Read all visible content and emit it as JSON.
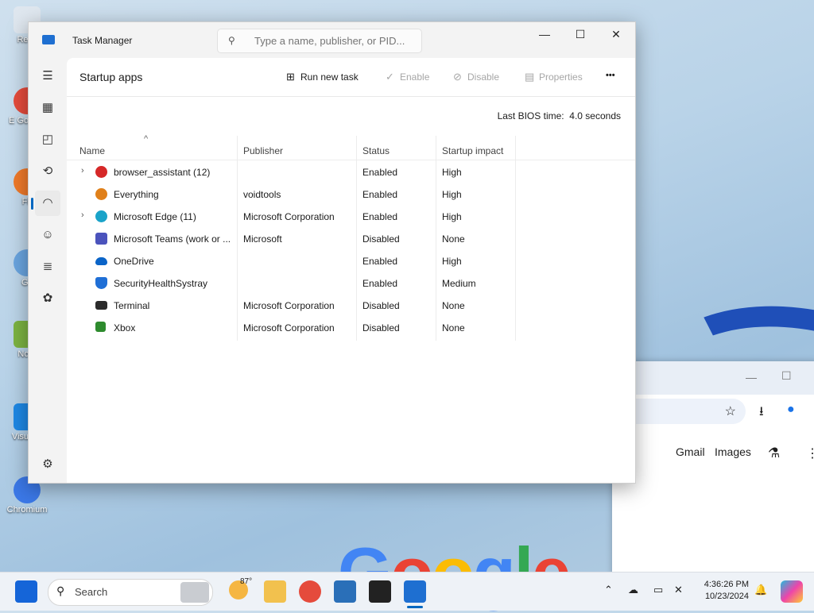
{
  "desktop": {
    "icons": [
      {
        "label": "Recy"
      },
      {
        "label": "E Go Chr"
      },
      {
        "label": "Fir"
      },
      {
        "label": "Git"
      },
      {
        "label": "Note"
      },
      {
        "label": "Visua C"
      },
      {
        "label": "Chromium"
      }
    ]
  },
  "browser": {
    "links": [
      "Gmail",
      "Images"
    ],
    "logo_text": "Google"
  },
  "window": {
    "title": "Task Manager",
    "search_placeholder": "Type a name, publisher, or PID...",
    "controls": {
      "minimize": "—",
      "maximize": "☐",
      "close": "✕"
    }
  },
  "sidebar": {
    "items": [
      {
        "name": "hamburger-menu-icon",
        "glyph": "☰"
      },
      {
        "name": "processes-icon",
        "glyph": "▦"
      },
      {
        "name": "performance-icon",
        "glyph": "◰"
      },
      {
        "name": "app-history-icon",
        "glyph": "⟲"
      },
      {
        "name": "startup-apps-icon",
        "glyph": "◠",
        "active": true
      },
      {
        "name": "users-icon",
        "glyph": "☺"
      },
      {
        "name": "details-icon",
        "glyph": "≣"
      },
      {
        "name": "services-icon",
        "glyph": "✿"
      }
    ],
    "settings_glyph": "⚙"
  },
  "page": {
    "title": "Startup apps",
    "commands": {
      "run_new_task": "Run new task",
      "enable": "Enable",
      "disable": "Disable",
      "properties": "Properties",
      "more": "•••"
    },
    "bios_label": "Last BIOS time:",
    "bios_value": "4.0 seconds"
  },
  "table": {
    "columns": [
      "Name",
      "Publisher",
      "Status",
      "Startup impact"
    ],
    "sort_indicator": "^",
    "rows": [
      {
        "name": "browser_assistant (12)",
        "publisher": "",
        "status": "Enabled",
        "impact": "High",
        "expandable": true,
        "icon_color": "#d62828",
        "icon": "opera-icon"
      },
      {
        "name": "Everything",
        "publisher": "voidtools",
        "status": "Enabled",
        "impact": "High",
        "expandable": false,
        "icon_color": "#e0801a",
        "icon": "everything-icon"
      },
      {
        "name": "Microsoft Edge (11)",
        "publisher": "Microsoft Corporation",
        "status": "Enabled",
        "impact": "High",
        "expandable": true,
        "icon_color": "#1aa3c9",
        "icon": "edge-icon"
      },
      {
        "name": "Microsoft Teams (work or ...",
        "publisher": "Microsoft",
        "status": "Disabled",
        "impact": "None",
        "expandable": false,
        "icon_color": "#4b53bc",
        "icon": "teams-icon"
      },
      {
        "name": "OneDrive",
        "publisher": "",
        "status": "Enabled",
        "impact": "High",
        "expandable": false,
        "icon_color": "#0a64c8",
        "icon": "onedrive-icon"
      },
      {
        "name": "SecurityHealthSystray",
        "publisher": "",
        "status": "Enabled",
        "impact": "Medium",
        "expandable": false,
        "icon_color": "#1f6fd6",
        "icon": "shield-icon"
      },
      {
        "name": "Terminal",
        "publisher": "Microsoft Corporation",
        "status": "Disabled",
        "impact": "None",
        "expandable": false,
        "icon_color": "#2b2b2b",
        "icon": "terminal-icon"
      },
      {
        "name": "Xbox",
        "publisher": "Microsoft Corporation",
        "status": "Disabled",
        "impact": "None",
        "expandable": false,
        "icon_color": "#2e8b2e",
        "icon": "xbox-icon"
      }
    ]
  },
  "taskbar": {
    "search_label": "Search",
    "weather_temp": "87°",
    "time": "4:36:26 PM",
    "date": "10/23/2024"
  },
  "colors": {
    "accent": "#0067c0"
  }
}
